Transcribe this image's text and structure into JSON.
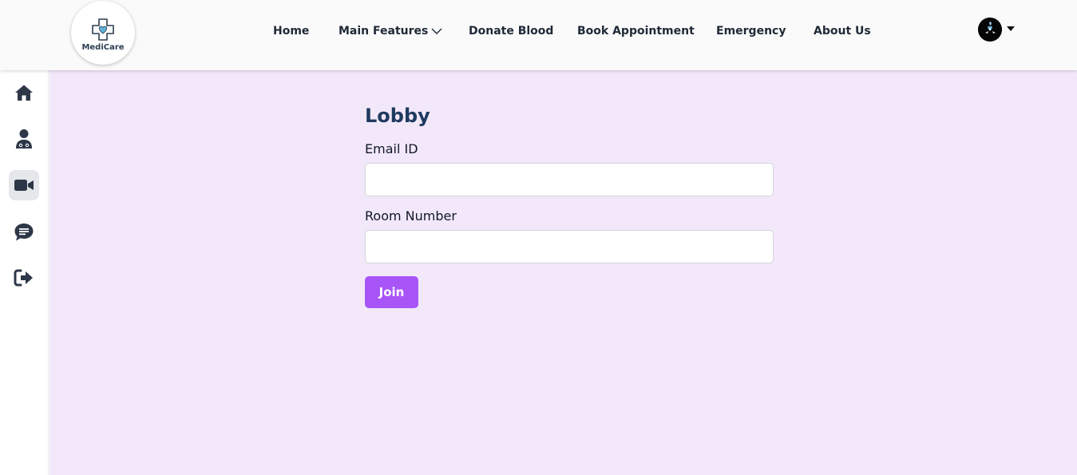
{
  "brand": {
    "name": "MediCare",
    "logo_icon": "medical-cross-heart-icon",
    "color": "#2c3e50"
  },
  "nav": {
    "home": "Home",
    "main_features": "Main Features",
    "donate_blood": "Donate Blood",
    "book_appointment": "Book Appointment",
    "emergency": "Emergency",
    "about_us": "About Us"
  },
  "user": {
    "avatar_icon": "user-avatar",
    "menu_icon": "caret-down-icon"
  },
  "sidebar": {
    "items": [
      {
        "name": "home",
        "icon": "home-icon",
        "active": false
      },
      {
        "name": "doctor",
        "icon": "doctor-icon",
        "active": false
      },
      {
        "name": "video-call",
        "icon": "video-camera-icon",
        "active": true
      },
      {
        "name": "chat",
        "icon": "chat-bubble-icon",
        "active": false
      },
      {
        "name": "logout",
        "icon": "logout-icon",
        "active": false
      }
    ]
  },
  "lobby": {
    "title": "Lobby",
    "email_label": "Email ID",
    "email_value": "",
    "room_label": "Room Number",
    "room_value": "",
    "join_label": "Join"
  },
  "colors": {
    "accent": "#a855f7",
    "main_bg": "#f2e8f9",
    "title": "#1e3a5f"
  }
}
